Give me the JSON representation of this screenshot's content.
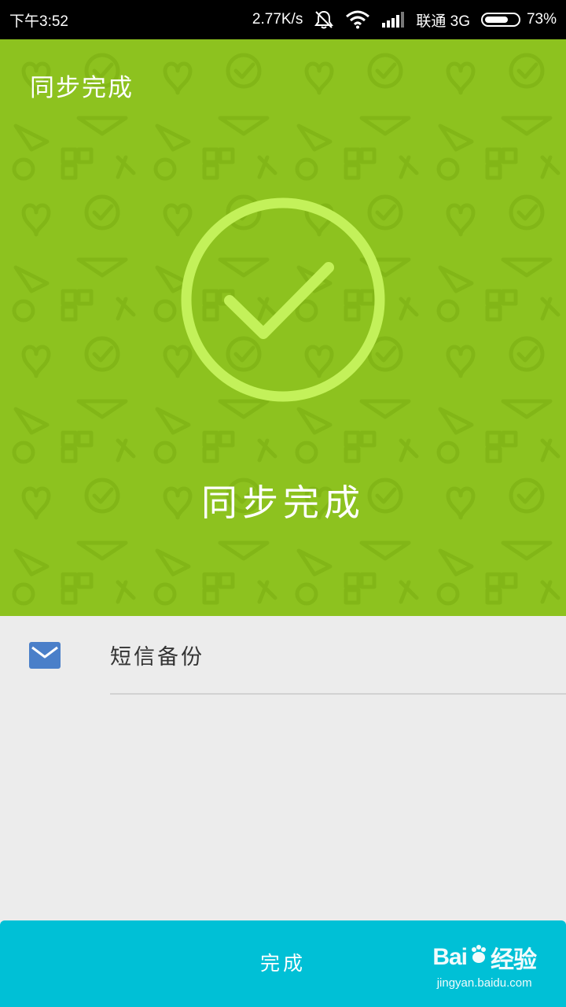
{
  "status_bar": {
    "time": "下午3:52",
    "net_speed": "2.77K/s",
    "carrier": "联通 3G",
    "battery_percent": "73%",
    "battery_level": 0.73,
    "icons": [
      "mute-bell-icon",
      "wifi-icon",
      "signal-icon",
      "battery-icon"
    ]
  },
  "header": {
    "title": "同步完成"
  },
  "hero": {
    "message": "同步完成",
    "icon": "check-circle-icon",
    "colors": {
      "background": "#8dc21f",
      "ring": "#c3f15a"
    }
  },
  "list": {
    "items": [
      {
        "icon": "mail-icon",
        "label": "短信备份"
      }
    ]
  },
  "footer": {
    "done_label": "完成",
    "color": "#00c0d6"
  },
  "watermark": {
    "logo_text": "Bai",
    "logo_text_2": "经验",
    "url": "jingyan.baidu.com"
  }
}
